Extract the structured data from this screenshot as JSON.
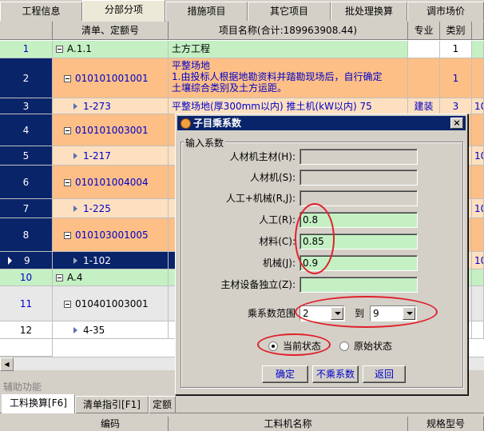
{
  "top_tabs": [
    {
      "label": "工程信息"
    },
    {
      "label": "分部分项"
    },
    {
      "label": "措施项目"
    },
    {
      "label": "其它项目"
    },
    {
      "label": "批处理换算"
    },
    {
      "label": "调市场价"
    }
  ],
  "grid": {
    "headers": [
      "清单、定额号",
      "项目名称(合计:189963908.44)",
      "专业",
      "类别"
    ],
    "rows": [
      {
        "num": "1",
        "code": "A.1.1",
        "name": "土方工程",
        "major": "",
        "cat": "1",
        "extra": ""
      },
      {
        "num": "2",
        "code": "010101001001",
        "name": "平整场地",
        "name2": "1.由投标人根据地勘资料并踏勘现场后，自行确定",
        "name3": "土壤综合类别及土方运距。",
        "major": "",
        "cat": "1",
        "extra": ""
      },
      {
        "num": "3",
        "code": "1-273",
        "name": "平整场地(厚300mm以内) 推土机(kW以内) 75",
        "major": "建装",
        "cat": "3",
        "extra": "10"
      },
      {
        "num": "4",
        "code": "010101003001",
        "name": "",
        "major": "",
        "cat": "",
        "extra": ""
      },
      {
        "num": "5",
        "code": "1-217",
        "name": "",
        "major": "",
        "cat": "",
        "extra": "10"
      },
      {
        "num": "6",
        "code": "010101004004",
        "name": "",
        "major": "",
        "cat": "",
        "extra": ""
      },
      {
        "num": "7",
        "code": "1-225",
        "name": "",
        "major": "",
        "cat": "",
        "extra": "10"
      },
      {
        "num": "8",
        "code": "010103001005",
        "name": "",
        "major": "",
        "cat": "",
        "extra": ""
      },
      {
        "num": "9",
        "code": "1-102",
        "name": "",
        "major": "",
        "cat": "",
        "extra": "10"
      },
      {
        "num": "10",
        "code": "A.4",
        "name": "",
        "major": "",
        "cat": "",
        "extra": ""
      },
      {
        "num": "11",
        "code": "010401003001",
        "name": "",
        "major": "",
        "cat": "",
        "extra": ""
      },
      {
        "num": "12",
        "code": "4-35",
        "name": "",
        "major": "",
        "cat": "",
        "extra": ""
      }
    ]
  },
  "aux": {
    "title": "辅助功能",
    "tabs": [
      "工料换算[F6]",
      "清单指引[F1]",
      "定额"
    ],
    "headers": [
      "编码",
      "工料机名称",
      "规格型号"
    ]
  },
  "dialog": {
    "title": "子目乘系数",
    "close_glyph": "×",
    "group_label": "输入系数",
    "fields": [
      {
        "label": "人材机主材(H):",
        "value": ""
      },
      {
        "label": "人材机(S):",
        "value": ""
      },
      {
        "label": "人工+机械(R,J):",
        "value": ""
      },
      {
        "label": "人工(R):",
        "value": "0.8"
      },
      {
        "label": "材料(C):",
        "value": "0.85"
      },
      {
        "label": "机械(J):",
        "value": "0.9"
      },
      {
        "label": "主材设备独立(Z):",
        "value": ""
      }
    ],
    "range_label": "乘系数范围",
    "range_from": "2",
    "range_to_label": "到",
    "range_to": "9",
    "radio_current": "当前状态",
    "radio_original": "原始状态",
    "btn_ok": "确定",
    "btn_no_coef": "不乘系数",
    "btn_back": "返回"
  },
  "colors": {
    "selection": "#0a246a",
    "list_bill": "#fdbf86",
    "section": "#c4f0c4",
    "annotation": "#e0202a"
  }
}
